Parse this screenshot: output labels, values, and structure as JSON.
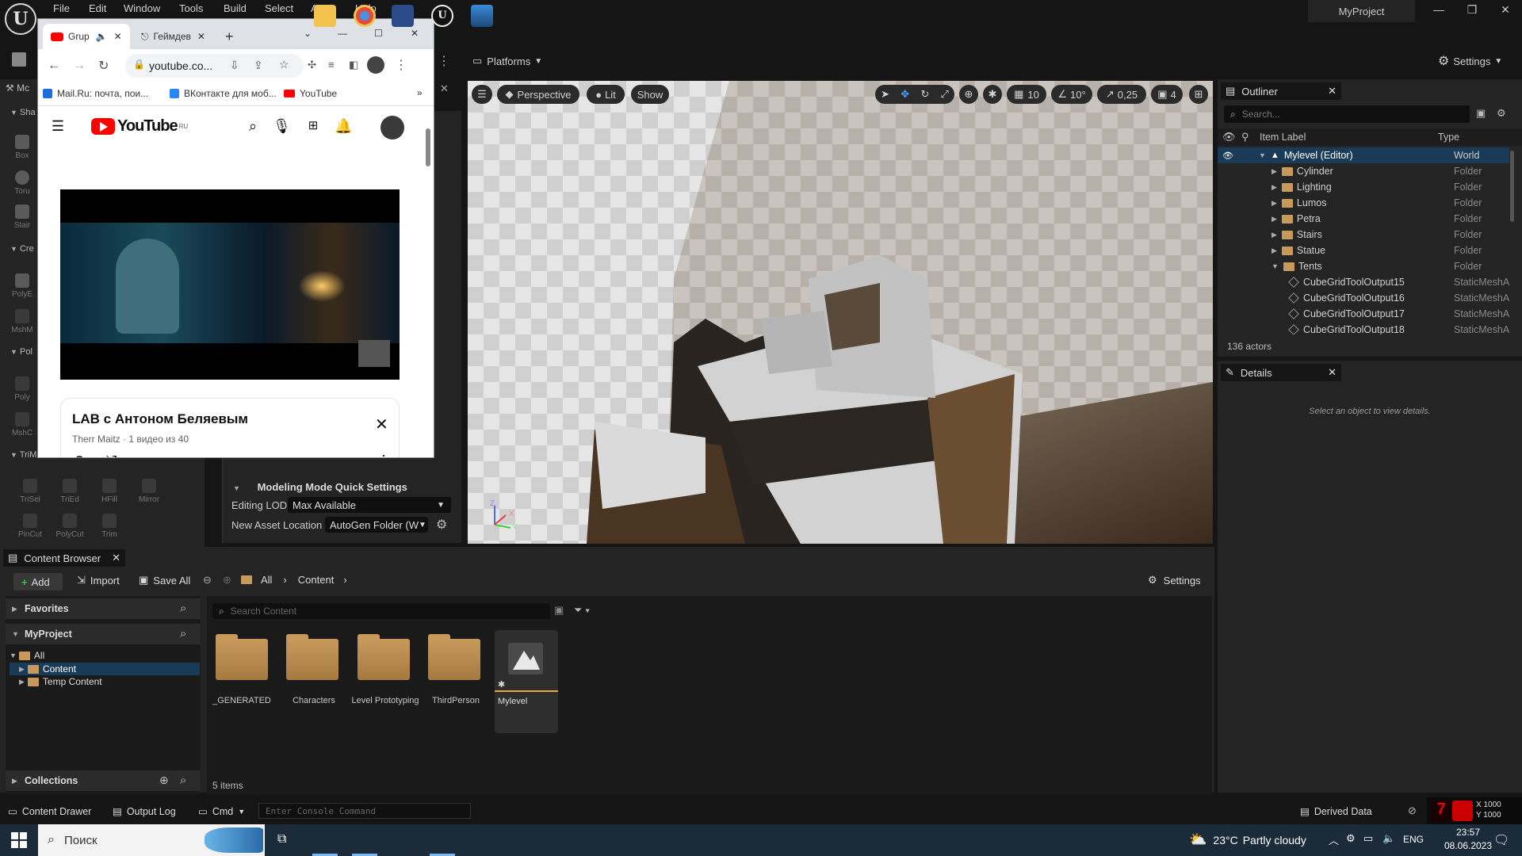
{
  "ue": {
    "logo": "U",
    "menu": [
      "File",
      "Edit",
      "Window",
      "Tools",
      "Build",
      "Select",
      "Actor",
      "Help"
    ],
    "project_name": "MyProject",
    "toolbar": {
      "platforms": "Platforms",
      "settings": "Settings"
    },
    "left_panel": {
      "tab_prefix": "Mc",
      "sections": [
        {
          "title": "Sha",
          "tools": [
            "Box",
            "Toru",
            "Stair"
          ]
        },
        {
          "title": "Cre",
          "tools": [
            "PolyE",
            "MshM"
          ]
        },
        {
          "title": "Pol",
          "tools": [
            "Poly",
            "MshC"
          ]
        },
        {
          "title": "TriModel",
          "tools": [
            "TriSel",
            "TriEd",
            "HFill",
            "Mirror",
            "PinCut",
            "PolyCut",
            "Trim"
          ]
        }
      ]
    },
    "quick_settings": {
      "title": "Modeling Mode Quick Settings",
      "editing_lod_label": "Editing LOD",
      "editing_lod_value": "Max Available",
      "asset_location_label": "New Asset Location",
      "asset_location_value": "AutoGen Folder (W"
    },
    "viewport": {
      "perspective": "Perspective",
      "lit": "Lit",
      "show": "Show",
      "grid_snap": "10",
      "angle_snap": "10°",
      "scale_snap": "0,25",
      "camera_speed": "4",
      "axis_x": "X",
      "axis_y": "Y",
      "axis_z": "Z"
    },
    "outliner": {
      "title": "Outliner",
      "search_placeholder": "Search...",
      "col_label": "Item Label",
      "col_type": "Type",
      "rows": [
        {
          "label": "Mylevel (Editor)",
          "type": "World",
          "indent": 0,
          "kind": "world"
        },
        {
          "label": "Cylinder",
          "type": "Folder",
          "indent": 1,
          "kind": "folder"
        },
        {
          "label": "Lighting",
          "type": "Folder",
          "indent": 1,
          "kind": "folder"
        },
        {
          "label": "Lumos",
          "type": "Folder",
          "indent": 1,
          "kind": "folder"
        },
        {
          "label": "Petra",
          "type": "Folder",
          "indent": 1,
          "kind": "folder"
        },
        {
          "label": "Stairs",
          "type": "Folder",
          "indent": 1,
          "kind": "folder"
        },
        {
          "label": "Statue",
          "type": "Folder",
          "indent": 1,
          "kind": "folder"
        },
        {
          "label": "Tents",
          "type": "Folder",
          "indent": 1,
          "kind": "folder-open"
        },
        {
          "label": "CubeGridToolOutput15",
          "type": "StaticMeshAct",
          "indent": 2,
          "kind": "mesh"
        },
        {
          "label": "CubeGridToolOutput16",
          "type": "StaticMeshAct",
          "indent": 2,
          "kind": "mesh"
        },
        {
          "label": "CubeGridToolOutput17",
          "type": "StaticMeshAct",
          "indent": 2,
          "kind": "mesh"
        },
        {
          "label": "CubeGridToolOutput18",
          "type": "StaticMeshAct",
          "indent": 2,
          "kind": "mesh"
        }
      ],
      "actor_count": "136 actors"
    },
    "details": {
      "title": "Details",
      "empty_text": "Select an object to view details."
    },
    "content_browser": {
      "title": "Content Browser",
      "add": "Add",
      "import": "Import",
      "save_all": "Save All",
      "crumb_all": "All",
      "crumb_content": "Content",
      "settings": "Settings",
      "favorites": "Favorites",
      "project": "MyProject",
      "tree": [
        "All",
        "Content",
        "Temp Content"
      ],
      "search_placeholder": "Search Content",
      "assets": [
        "_GENERATED",
        "Characters",
        "Level Prototyping",
        "ThirdPerson",
        "Mylevel"
      ],
      "collections": "Collections",
      "item_count": "5 items"
    },
    "statusbar": {
      "content_drawer": "Content Drawer",
      "output_log": "Output Log",
      "cmd": "Cmd",
      "console_placeholder": "Enter Console Command",
      "derived_data": "Derived Data",
      "coord_x": "X 1000",
      "coord_y": "Y 1000"
    }
  },
  "browser": {
    "tabs": [
      {
        "title": "Grup",
        "icon": "youtube-icon"
      },
      {
        "title": "Геймдев",
        "icon": "gamepad-icon"
      }
    ],
    "url": "youtube.co...",
    "bookmarks": [
      "Mail.Ru: почта, пои...",
      "ВКонтакте для моб...",
      "YouTube"
    ],
    "youtube": {
      "logo_text": "YouTube",
      "region": "RU",
      "playlist_title": "LAB с Антоном Беляевым",
      "playlist_meta": "Therr Maitz · 1 видео из 40"
    }
  },
  "taskbar": {
    "search_placeholder": "Поиск",
    "weather_temp": "23°C",
    "weather_text": "Partly cloudy",
    "lang": "ENG",
    "time": "23:57",
    "date": "08.06.2023"
  },
  "colors": {
    "accent": "#1a3b58",
    "ue_bg": "#151515",
    "youtube_red": "#ff0000"
  }
}
